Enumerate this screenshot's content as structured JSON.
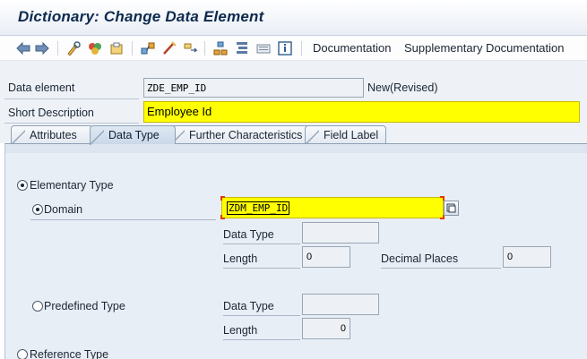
{
  "window": {
    "title": "Dictionary: Change Data Element"
  },
  "toolbar": {
    "icons": [
      "back-icon",
      "forward-icon",
      "display-change-icon",
      "activate-icon",
      "where-used-icon",
      "object-list-icon",
      "navigation-window-icon",
      "hierarchy-icon",
      "layout-icon",
      "print-icon",
      "info-icon"
    ],
    "documentation_label": "Documentation",
    "supplementary_label": "Supplementary Documentation"
  },
  "header": {
    "data_element_label": "Data element",
    "data_element_value": "ZDE_EMP_ID",
    "status": "New(Revised)",
    "short_description_label": "Short Description",
    "short_description_value": "Employee Id"
  },
  "tabs": [
    {
      "label": "Attributes",
      "active": false
    },
    {
      "label": "Data Type",
      "active": true
    },
    {
      "label": "Further Characteristics",
      "active": false
    },
    {
      "label": "Field Label",
      "active": false
    }
  ],
  "data_type_tab": {
    "elementary_type_label": "Elementary Type",
    "domain_label": "Domain",
    "domain_value": "ZDM_EMP_ID",
    "domain_data_type_label": "Data Type",
    "domain_data_type_value": "",
    "domain_length_label": "Length",
    "domain_length_value": "0",
    "decimal_places_label": "Decimal Places",
    "decimal_places_value": "0",
    "predefined_type_label": "Predefined Type",
    "predefined_data_type_label": "Data Type",
    "predefined_data_type_value": "",
    "predefined_length_label": "Length",
    "predefined_length_value": "0",
    "reference_type_label": "Reference Type",
    "selected": "Domain"
  },
  "colors": {
    "required_field": "#ffff00",
    "title": "#0d2a4e",
    "panel": "#e8eef5"
  }
}
